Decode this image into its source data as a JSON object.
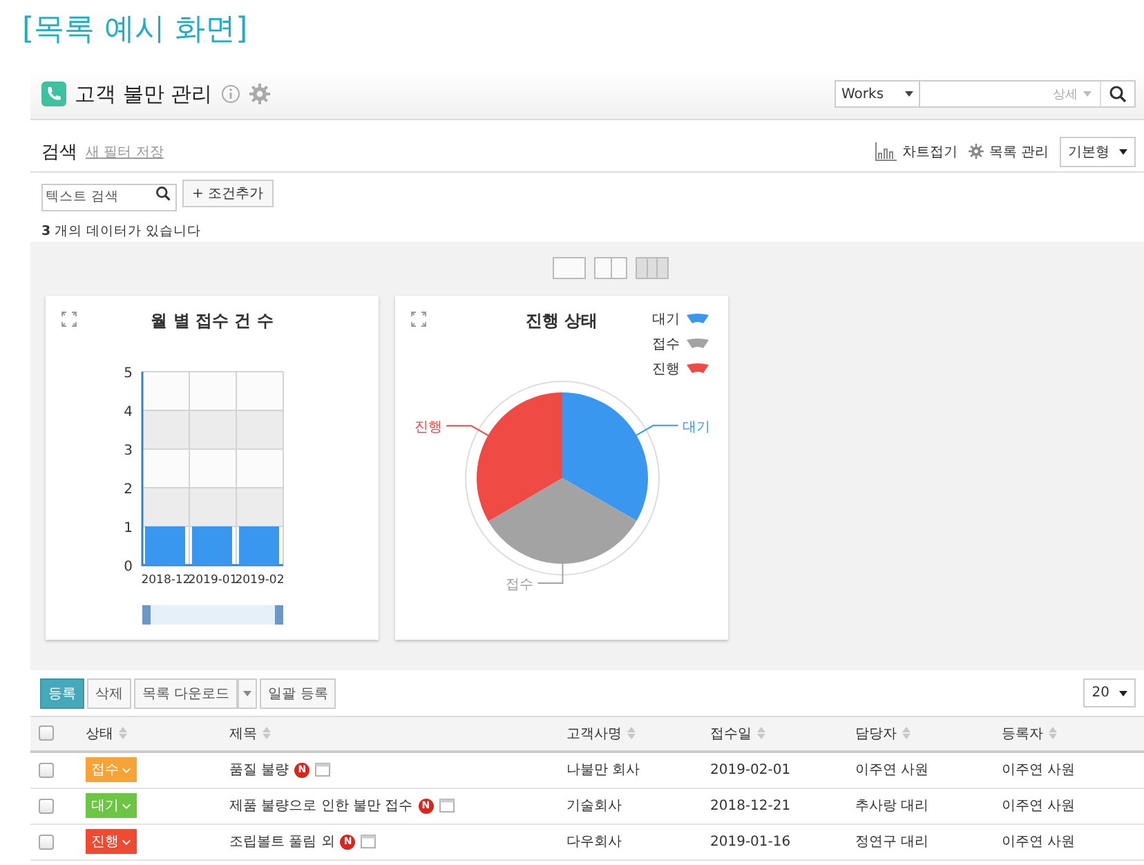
{
  "page_title": "[목록 예시 화면]",
  "header": {
    "title": "고객 불만 관리",
    "scope_select": "Works",
    "search_option": "상세"
  },
  "filter_bar": {
    "title": "검색",
    "save_filter_link": "새 필터 저장",
    "chart_toggle": "차트접기",
    "list_manage": "목록 관리",
    "view_select": "기본형"
  },
  "search": {
    "placeholder": "텍스트 검색",
    "add_condition": "+ 조건추가"
  },
  "result_count": "**3** 개의 데이터가 있습니다",
  "layout_options": [
    {
      "kind": "one",
      "selected": false
    },
    {
      "kind": "two",
      "selected": false
    },
    {
      "kind": "three",
      "selected": true
    }
  ],
  "charts": [
    {
      "chart_data": {
        "type": "bar",
        "title": "월 별 접수 건 수",
        "categories": [
          "2018-12",
          "2019-01",
          "2019-02"
        ],
        "series": [
          {
            "color": "#3a97f0",
            "values": [
              1,
              1,
              1
            ]
          }
        ],
        "ylim": [
          0,
          5
        ],
        "yticks": [
          0,
          1,
          2,
          3,
          4,
          5
        ],
        "grid": true
      }
    },
    {
      "chart_data": {
        "type": "pie",
        "title": "진행 상태",
        "categories": [
          "대기",
          "접수",
          "진행"
        ],
        "colors": [
          "#3a97f0",
          "#a3a3a3",
          "#f04a45"
        ],
        "series": [
          {
            "values": [
              33.3,
              33.3,
              33.4
            ]
          }
        ]
      },
      "legend": [
        {
          "label": "대기",
          "color": "#3a97f0"
        },
        {
          "label": "접수",
          "color": "#a3a3a3"
        },
        {
          "label": "진행",
          "color": "#f04a45"
        }
      ]
    }
  ],
  "toolbar": {
    "buttons": [
      {
        "kind": "primary",
        "label": "등록"
      },
      {
        "kind": "plain",
        "label": "삭제"
      },
      {
        "kind": "split",
        "label": "목록 다운로드"
      },
      {
        "kind": "plain",
        "label": "일괄 등록"
      }
    ],
    "page_size": "20"
  },
  "table": {
    "select_all_checked": false,
    "columns": [
      "상태",
      "제목",
      "고객사명",
      "접수일",
      "담당자",
      "등록자"
    ],
    "rows": [
      {
        "checked": false,
        "status": "접수",
        "color": "#f7a336",
        "title": {
          "text": "품질 불량",
          "badge": "N"
        },
        "company": "나불만 회사",
        "date": "2019-02-01",
        "manager": "이주연 사원",
        "registrant": "이주연 사원"
      },
      {
        "checked": false,
        "status": "대기",
        "color": "#6cc644",
        "title": {
          "text": "제품 불량으로 인한 불만 접수",
          "badge": "N"
        },
        "company": "기술회사",
        "date": "2018-12-21",
        "manager": "추사랑 대리",
        "registrant": "이주연 사원"
      },
      {
        "checked": false,
        "status": "진행",
        "color": "#ef4b33",
        "title": {
          "text": "조립볼트 풀림 외",
          "badge": "N"
        },
        "company": "다우회사",
        "date": "2019-01-16",
        "manager": "정연구 대리",
        "registrant": "이주연 사원"
      }
    ]
  }
}
